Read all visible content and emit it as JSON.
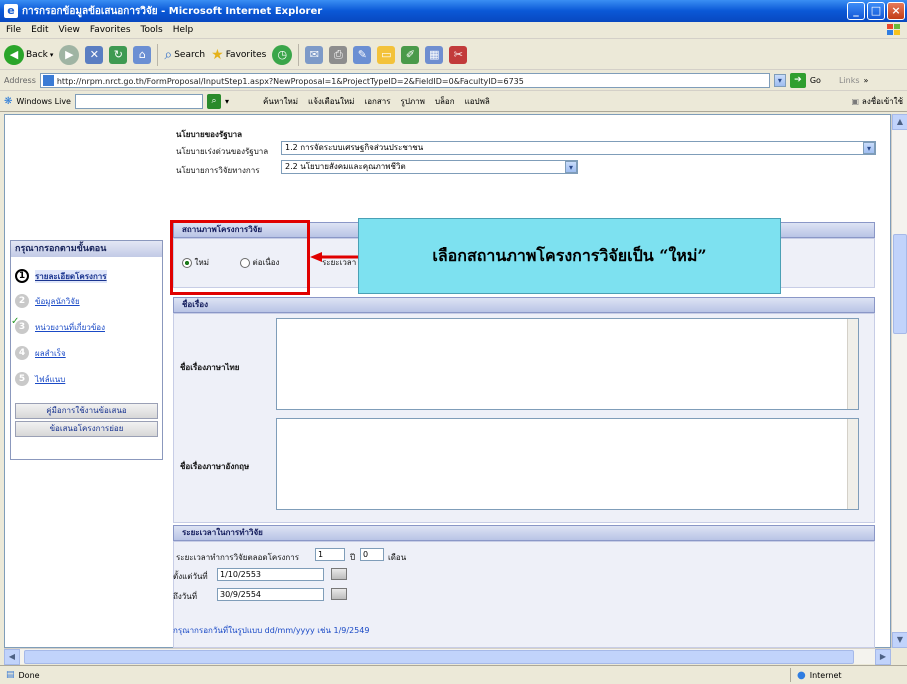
{
  "window": {
    "title": "การกรอกข้อมูลข้อเสนอการวิจัย - Microsoft Internet Explorer"
  },
  "menu": [
    "File",
    "Edit",
    "View",
    "Favorites",
    "Tools",
    "Help"
  ],
  "toolbar": {
    "back": "Back",
    "search": "Search",
    "favorites": "Favorites"
  },
  "address": {
    "label": "Address",
    "url": "http://nrpm.nrct.go.th/FormProposal/InputStep1.aspx?NewProposal=1&ProjectTypeID=2&FieldID=0&FacultyID=6735",
    "go": "Go",
    "links": "Links"
  },
  "windows_live": {
    "label": "Windows Live",
    "links": [
      "ค้นหาใหม่",
      "แจ้งเตือนใหม่",
      "เอกสาร",
      "รูปภาพ",
      "บล็อก",
      "แอปพลิ"
    ],
    "signin": "ลงชื่อเข้าใช้"
  },
  "left_panel": {
    "title": "กรุณากรอกตามขั้นตอน",
    "steps": [
      {
        "num": "1",
        "label": "รายละเอียดโครงการ"
      },
      {
        "num": "2",
        "label": "ข้อมูลนักวิจัย"
      },
      {
        "num": "3",
        "label": "หน่วยงานที่เกี่ยวข้อง"
      },
      {
        "num": "4",
        "label": "ผลสำเร็จ"
      },
      {
        "num": "5",
        "label": "ไฟล์แนบ"
      }
    ],
    "buttons": [
      "คู่มือการใช้งานข้อเสนอ",
      "ข้อเสนอโครงการย่อย"
    ]
  },
  "policy": {
    "heading": "นโยบายของรัฐบาล",
    "row1_label": "นโยบายเร่งด่วนของรัฐบาล",
    "row1_value": "1.2 การจัดระบบเศรษฐกิจส่วนประชาชน",
    "row2_label": "นโยบายการวิจัยทางการ",
    "row2_value": "2.2 นโยบายสังคมและคุณภาพชีวิต"
  },
  "status_section": {
    "heading": "สถานภาพโครงการวิจัย",
    "option_new": "ใหม่",
    "option_continue": "ต่อเนื่อง",
    "extra_label": "ระยะเวลา"
  },
  "callout": {
    "text": "เลือกสถานภาพโครงการวิจัยเป็น “ใหม่”"
  },
  "title_section": {
    "heading": "ชื่อเรื่อง",
    "thai_label": "ชื่อเรื่องภาษาไทย",
    "eng_label": "ชื่อเรื่องภาษาอังกฤษ"
  },
  "duration_section": {
    "heading": "ระยะเวลาในการทำวิจัย",
    "duration_label": "ระยะเวลาทำการวิจัยตลอดโครงการ",
    "years": "1",
    "months_label": "ปี",
    "months": "0",
    "month_unit": "เดือน",
    "start_label": "ตั้งแต่วันที่",
    "start_value": "1/10/2553",
    "end_label": "ถึงวันที่",
    "end_value": "30/9/2554",
    "hint": "กรุณากรอกวันที่ในรูปแบบ dd/mm/yyyy เช่น 1/9/2549"
  },
  "status": {
    "left": "Done",
    "zone": "Internet"
  }
}
